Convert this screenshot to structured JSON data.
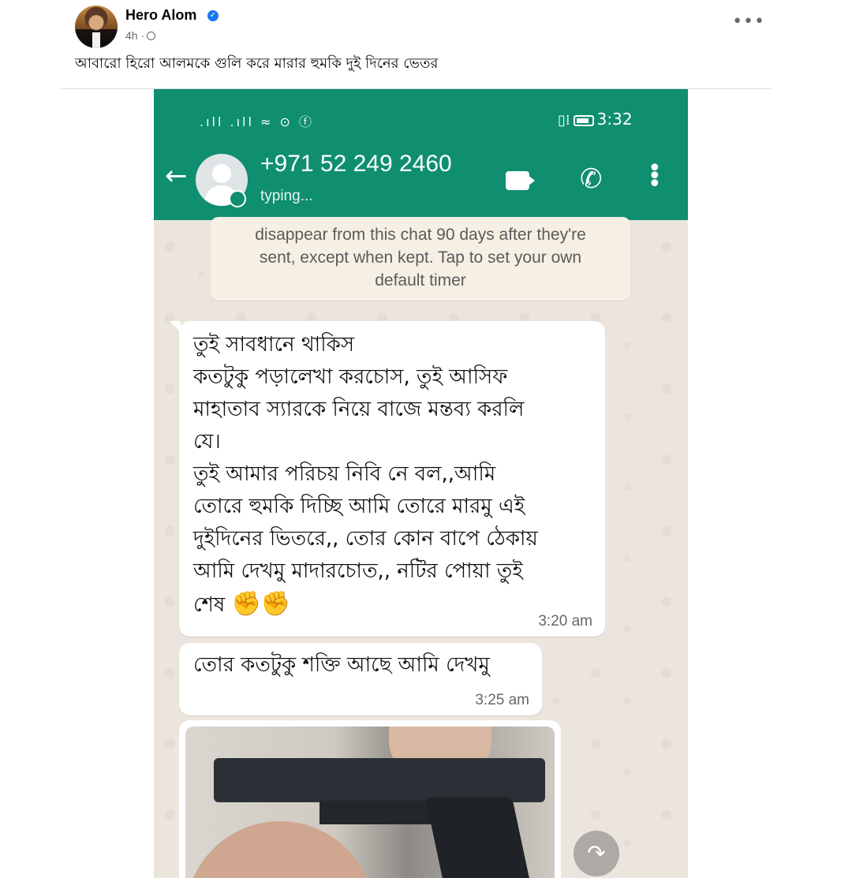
{
  "post": {
    "author": "Hero Alom",
    "time": "4h ·",
    "caption": "আবারো হিরো আলমকে গুলি করে মারার হুমকি দুই দিনের ভেতর",
    "more": "•••"
  },
  "whatsapp": {
    "status_bar": {
      "left_icons": ".ıll .ıll ≈ ⊙ ⓕ",
      "right_icons": "▯⁞",
      "time": "3:32"
    },
    "contact": {
      "number": "+971 52 249 2460",
      "status": "typing..."
    },
    "system_note": [
      "disappear from this chat 90 days after they're",
      "sent, except when kept. Tap to set your own",
      "default timer"
    ],
    "messages": [
      {
        "lines": [
          "তুই সাবধানে থাকিস",
          "কতটুকু পড়ালেখা করচোস, তুই আসিফ",
          "মাহাতাব স্যারকে নিয়ে বাজে মন্তব্য করলি",
          "যে।",
          "তুই আমার পরিচয় নিবি নে বল,,আমি",
          "তোরে হুমকি দিচ্ছি আমি তোরে মারমু এই",
          "দুইদিনের ভিতরে,, তোর কোন বাপে ঠেকায়",
          "আমি দেখমু মাদারচোত,, নটির পোয়া তুই",
          "শেষ"
        ],
        "emoji": "✊✊",
        "time": "3:20 am"
      },
      {
        "lines": [
          "তোর কতটুকু শক্তি আছে আমি দেখমু"
        ],
        "time": "3:25 am"
      }
    ],
    "icons": {
      "back": "←",
      "phone": "✆",
      "menu": "⋮",
      "share": "↷"
    }
  }
}
